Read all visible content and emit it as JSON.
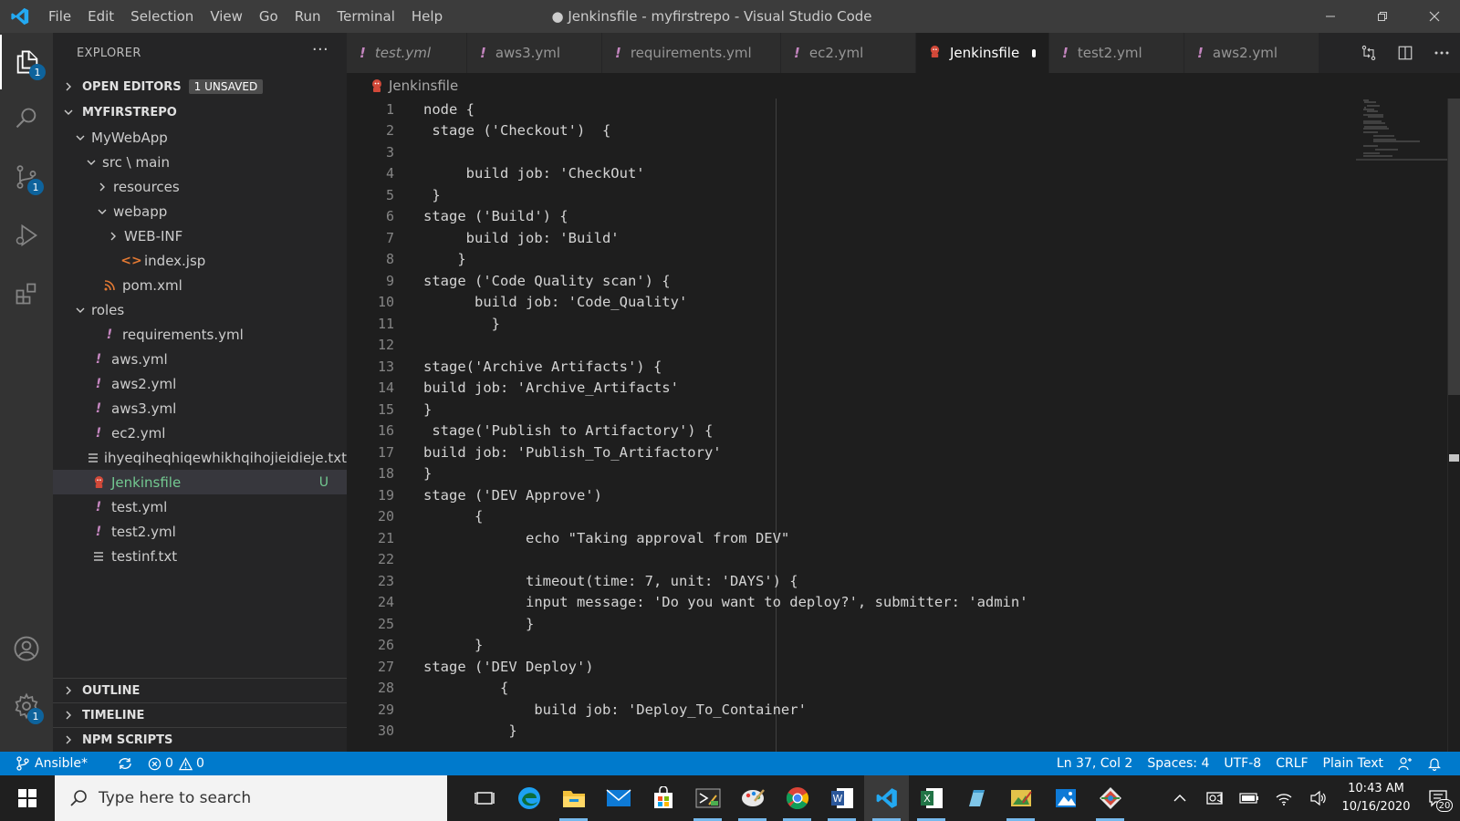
{
  "window": {
    "title": "● Jenkinsfile - myfirstrepo - Visual Studio Code",
    "menu": [
      "File",
      "Edit",
      "Selection",
      "View",
      "Go",
      "Run",
      "Terminal",
      "Help"
    ]
  },
  "activity": {
    "explorer_badge": "1",
    "scm_badge": "1",
    "settings_badge": "1"
  },
  "sidebar": {
    "header": "EXPLORER",
    "more": "···",
    "open_editors": "OPEN EDITORS",
    "unsaved": "1 UNSAVED",
    "repo": "MYFIRSTREPO",
    "tree": [
      {
        "label": "MyWebApp",
        "indent": 1,
        "type": "folder-open"
      },
      {
        "label": "src \\ main",
        "indent": 2,
        "type": "folder-open"
      },
      {
        "label": "resources",
        "indent": 3,
        "type": "folder-closed"
      },
      {
        "label": "webapp",
        "indent": 3,
        "type": "folder-open"
      },
      {
        "label": "WEB-INF",
        "indent": 4,
        "type": "folder-closed"
      },
      {
        "label": "index.jsp",
        "indent": 4,
        "type": "file-jsp"
      },
      {
        "label": "pom.xml",
        "indent": 2,
        "type": "file-xml"
      },
      {
        "label": "roles",
        "indent": 1,
        "type": "folder-open"
      },
      {
        "label": "requirements.yml",
        "indent": 2,
        "type": "file-yml"
      },
      {
        "label": "aws.yml",
        "indent": 1,
        "type": "file-yml"
      },
      {
        "label": "aws2.yml",
        "indent": 1,
        "type": "file-yml"
      },
      {
        "label": "aws3.yml",
        "indent": 1,
        "type": "file-yml"
      },
      {
        "label": "ec2.yml",
        "indent": 1,
        "type": "file-yml"
      },
      {
        "label": "ihyeqiheqhiqewhikhqihojieidieje.txt",
        "indent": 1,
        "type": "file-txt"
      },
      {
        "label": "Jenkinsfile",
        "indent": 1,
        "type": "file-jenkins",
        "selected": true,
        "deco": "U"
      },
      {
        "label": "test.yml",
        "indent": 1,
        "type": "file-yml"
      },
      {
        "label": "test2.yml",
        "indent": 1,
        "type": "file-yml"
      },
      {
        "label": "testinf.txt",
        "indent": 1,
        "type": "file-txt"
      }
    ],
    "bottom": [
      "OUTLINE",
      "TIMELINE",
      "NPM SCRIPTS"
    ]
  },
  "tabs": [
    {
      "label": "test.yml",
      "italic": true,
      "icon": "yml"
    },
    {
      "label": "aws3.yml",
      "icon": "yml"
    },
    {
      "label": "requirements.yml",
      "icon": "yml"
    },
    {
      "label": "ec2.yml",
      "icon": "yml"
    },
    {
      "label": "Jenkinsfile",
      "icon": "jenkins",
      "active": true,
      "dirty": true
    },
    {
      "label": "test2.yml",
      "icon": "yml"
    },
    {
      "label": "aws2.yml",
      "icon": "yml"
    }
  ],
  "breadcrumb": "Jenkinsfile",
  "code": [
    "node {",
    " stage ('Checkout')  {",
    "",
    "     build job: 'CheckOut'",
    " }",
    "stage ('Build') {",
    "     build job: 'Build'",
    "    }",
    "stage ('Code Quality scan') {",
    "      build job: 'Code_Quality'",
    "        }",
    "",
    "stage('Archive Artifacts') {",
    "build job: 'Archive_Artifacts'",
    "}",
    " stage('Publish to Artifactory') {",
    "build job: 'Publish_To_Artifactory'",
    "}",
    "stage ('DEV Approve')",
    "      {",
    "            echo \"Taking approval from DEV\"",
    "",
    "            timeout(time: 7, unit: 'DAYS') {",
    "            input message: 'Do you want to deploy?', submitter: 'admin'",
    "            }",
    "      }",
    "stage ('DEV Deploy')",
    "         {",
    "             build job: 'Deploy_To_Container'",
    "          }"
  ],
  "status": {
    "branch": "Ansible*",
    "errors": "0",
    "warnings": "0",
    "position": "Ln 37, Col 2",
    "spaces": "Spaces: 4",
    "encoding": "UTF-8",
    "eol": "CRLF",
    "language": "Plain Text"
  },
  "taskbar": {
    "search_placeholder": "Type here to search",
    "time": "10:43 AM",
    "date": "10/16/2020",
    "notifications": "20"
  },
  "colors": {
    "accent": "#007acc",
    "yml_icon": "#c586c0",
    "untracked": "#73c991",
    "jenkins_icon": "#d24939"
  }
}
